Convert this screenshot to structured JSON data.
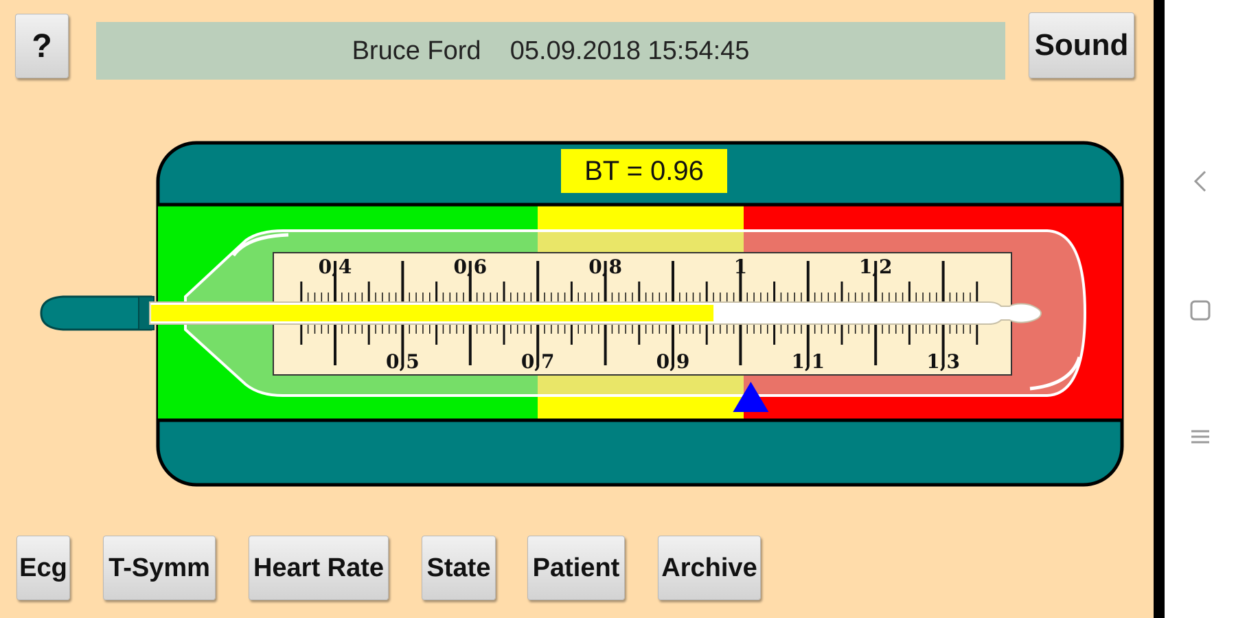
{
  "header": {
    "help_label": "?",
    "patient_name": "Bruce Ford",
    "datetime": "05.09.2018 15:54:45",
    "sound_label": "Sound"
  },
  "thermometer": {
    "readout": "BT = 0.96",
    "value": 0.96,
    "scale_min": 0.3,
    "scale_max": 1.35,
    "upper_labels": [
      "0,4",
      "0,6",
      "0,8",
      "1",
      "1,2"
    ],
    "lower_labels": [
      "0,5",
      "0,7",
      "0,9",
      "1,1",
      "1,3"
    ],
    "marker_value": 1.0,
    "zones": [
      {
        "name": "normal",
        "color": "#00ee00"
      },
      {
        "name": "warning",
        "color": "#ffff00"
      },
      {
        "name": "critical",
        "color": "#ff0000"
      }
    ],
    "fill_color": "#ffff00",
    "marker_color": "#0000ff",
    "frame_color": "#007f7f"
  },
  "bottom_nav": {
    "ecg": "Ecg",
    "t_symm": "T-Symm",
    "heart_rate": "Heart Rate",
    "state": "State",
    "patient": "Patient",
    "archive": "Archive"
  },
  "system_nav": {
    "back_icon": "chevron-left-icon",
    "home_icon": "square-icon",
    "recents_icon": "menu-lines-icon"
  }
}
